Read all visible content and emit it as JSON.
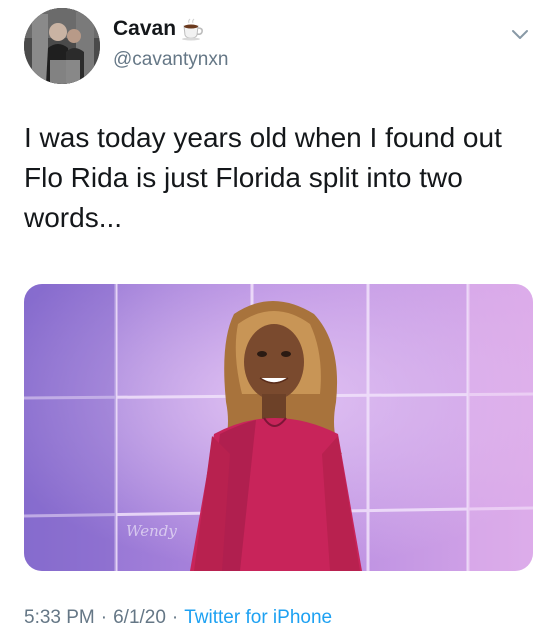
{
  "author": {
    "display_name": "Cavan",
    "name_emoji": "coffee-cup-icon",
    "handle": "@cavantynxn"
  },
  "tweet": {
    "text": "I was today years old when I found out Flo Rida is just Florida split into two words...",
    "media": {
      "watermark": "Wendy"
    }
  },
  "meta": {
    "time": "5:33 PM",
    "separator": "·",
    "date": "6/1/20",
    "source": "Twitter for iPhone"
  },
  "colors": {
    "text": "#14171a",
    "secondary": "#657786",
    "link": "#1da1f2",
    "dress": "#c8245a",
    "studio_purple": "#9b6fd6"
  }
}
